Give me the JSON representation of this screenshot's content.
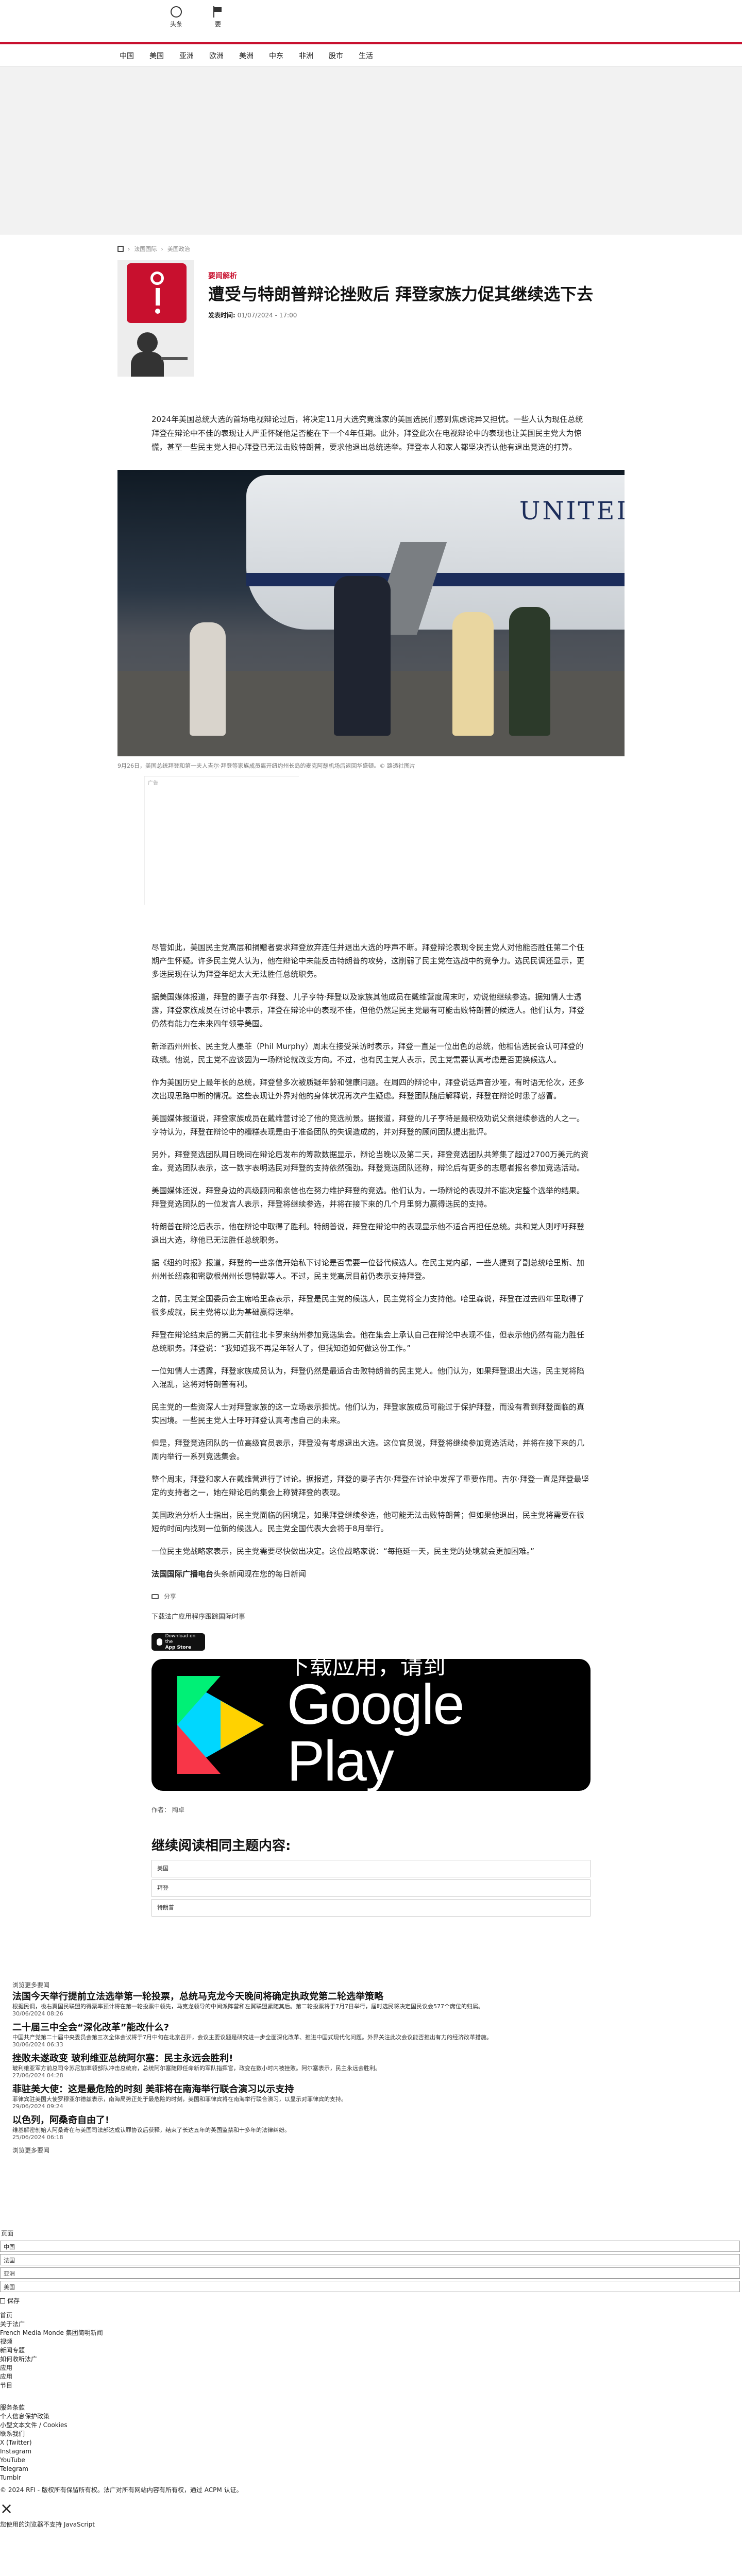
{
  "header": {
    "icons": [
      {
        "name": "home-icon",
        "label": "头条"
      },
      {
        "name": "flag-icon",
        "label": "要"
      }
    ],
    "nav": [
      "中国",
      "美国",
      "亚洲",
      "欧洲",
      "美洲",
      "中东",
      "非洲",
      "股市",
      "生活"
    ]
  },
  "breadcrumb": [
    "法国国际",
    "美国政治"
  ],
  "article": {
    "tag": "要闻解析",
    "title": "遭受与特朗普辩论挫败后 拜登家族力促其继续选下去",
    "date_label": "发表时间:",
    "date": "01/07/2024 - 17:00",
    "lead": "2024年美国总统大选的首场电视辩论过后，将决定11月大选究竟谁家的美国选民们感到焦虑诧异又担忧。一些人认为现任总统拜登在辩论中不佳的表现让人严重怀疑他是否能在下一个4年任期。此外，拜登此次在电视辩论中的表现也让美国民主党大为惊慌，甚至一些民主党人担心拜登已无法击败特朗普，要求他退出总统选举。拜登本人和家人都坚决否认他有退出竞选的打算。",
    "photo_caption": "9月26日，美国总统拜登和第一夫人吉尔·拜登等家族成员离开纽约州长岛的麦克阿瑟机场后返回华盛顿。© 路透社图片",
    "ad_label": "广告",
    "paragraphs": [
      "尽管如此，美国民主党高层和捐赠者要求拜登放弃连任并退出大选的呼声不断。拜登辩论表现令民主党人对他能否胜任第二个任期产生怀疑。许多民主党人认为，他在辩论中未能反击特朗普的攻势，这削弱了民主党在选战中的竞争力。选民民调还显示，更多选民现在认为拜登年纪太大无法胜任总统职务。",
      "据美国媒体报道，拜登的妻子吉尔·拜登、儿子亨特·拜登以及家族其他成员在戴维营度周末时，劝说他继续参选。据知情人士透露，拜登家族成员在讨论中表示，拜登在辩论中的表现不佳，但他仍然是民主党最有可能击败特朗普的候选人。他们认为，拜登仍然有能力在未来四年领导美国。",
      "新泽西州州长、民主党人墨菲（Phil Murphy）周末在接受采访时表示，拜登一直是一位出色的总统，他相信选民会认可拜登的政绩。他说，民主党不应该因为一场辩论就改变方向。不过，也有民主党人表示，民主党需要认真考虑是否更换候选人。",
      "作为美国历史上最年长的总统，拜登曾多次被质疑年龄和健康问题。在周四的辩论中，拜登说话声音沙哑，有时语无伦次，还多次出现思路中断的情况。这些表现让外界对他的身体状况再次产生疑虑。拜登团队随后解释说，拜登在辩论时患了感冒。",
      "美国媒体报道说，拜登家族成员在戴维营讨论了他的竞选前景。据报道，拜登的儿子亨特是最积极劝说父亲继续参选的人之一。亨特认为，拜登在辩论中的糟糕表现是由于准备团队的失误造成的，并对拜登的顾问团队提出批评。",
      "另外，拜登竞选团队周日晚间在辩论后发布的筹款数据显示，辩论当晚以及第二天，拜登竞选团队共筹集了超过2700万美元的资金。竞选团队表示，这一数字表明选民对拜登的支持依然强劲。拜登竞选团队还称，辩论后有更多的志愿者报名参加竞选活动。",
      "美国媒体还说，拜登身边的高级顾问和亲信也在努力维护拜登的竞选。他们认为，一场辩论的表现并不能决定整个选举的结果。拜登竞选团队的一位发言人表示，拜登将继续参选，并将在接下来的几个月里努力赢得选民的支持。",
      "特朗普在辩论后表示，他在辩论中取得了胜利。特朗普说，拜登在辩论中的表现显示他不适合再担任总统。共和党人则呼吁拜登退出大选，称他已无法胜任总统职务。",
      "据《纽约时报》报道，拜登的一些亲信开始私下讨论是否需要一位替代候选人。在民主党内部，一些人提到了副总统哈里斯、加州州长纽森和密歇根州州长惠特默等人。不过，民主党高层目前仍表示支持拜登。",
      "之前，民主党全国委员会主席哈里森表示，拜登是民主党的候选人，民主党将全力支持他。哈里森说，拜登在过去四年里取得了很多成就，民主党将以此为基础赢得选举。",
      "拜登在辩论结束后的第二天前往北卡罗来纳州参加竞选集会。他在集会上承认自己在辩论中表现不佳，但表示他仍然有能力胜任总统职务。拜登说：“我知道我不再是年轻人了，但我知道如何做这份工作。”",
      "一位知情人士透露，拜登家族成员认为，拜登仍然是最适合击败特朗普的民主党人。他们认为，如果拜登退出大选，民主党将陷入混乱，这将对特朗普有利。",
      "民主党的一些资深人士对拜登家族的这一立场表示担忧。他们认为，拜登家族成员可能过于保护拜登，而没有看到拜登面临的真实困境。一些民主党人士呼吁拜登认真考虑自己的未来。",
      "但是，拜登竞选团队的一位高级官员表示，拜登没有考虑退出大选。这位官员说，拜登将继续参加竞选活动，并将在接下来的几周内举行一系列竞选集会。",
      "整个周末，拜登和家人在戴维营进行了讨论。据报道，拜登的妻子吉尔·拜登在讨论中发挥了重要作用。吉尔·拜登一直是拜登最坚定的支持者之一，她在辩论后的集会上称赞拜登的表现。",
      "美国政治分析人士指出，民主党面临的困境是，如果拜登继续参选，他可能无法击败特朗普；但如果他退出，民主党将需要在很短的时间内找到一位新的候选人。民主党全国代表大会将于8月举行。",
      "一位民主党战略家表示，民主党需要尽快做出决定。这位战略家说：“每拖延一天，民主党的处境就会更加困难。”"
    ],
    "source_label": "法国国际广播电台",
    "source_text": "头条新闻现在您的每日新闻",
    "share_label": "分享",
    "download_line": "下载法广应用程序跟踪国际时事",
    "appstore_small": "Download on the",
    "appstore_big": "App Store",
    "gp_small": "下载应用，请到",
    "gp_big": "Google Play",
    "author_label": "作者：",
    "author": "陶卓",
    "related_title": "继续阅读相同主题内容:",
    "related": [
      "美国",
      "拜登",
      "特朗普"
    ]
  },
  "lower": {
    "more_label": "浏览更多要闻",
    "items": [
      {
        "title": "法国今天举行提前立法选举第一轮投票，总统马克龙今天晚间将确定执政党第二轮选举策略",
        "desc": "根据民调，极右翼国民联盟的得票率预计将在第一轮投票中领先，马克龙领导的中间派阵营和左翼联盟紧随其后。第二轮投票将于7月7日举行，届时选民将决定国民议会577个席位的归属。",
        "date": "30/06/2024 08:26"
      },
      {
        "title": "二十届三中全会“深化改革”能改什么?",
        "desc": "中国共产党第二十届中央委员会第三次全体会议将于7月中旬在北京召开，会议主要议题是研究进一步全面深化改革、推进中国式现代化问题。外界关注此次会议能否推出有力的经济改革措施。",
        "date": "30/06/2024 06:33"
      },
      {
        "title": "挫败未遂政变 玻利维亚总统阿尔塞：民主永远会胜利!",
        "desc": "玻利维亚军方前总司令苏尼加率领部队冲击总统府，总统阿尔塞随即任命新的军队指挥官，政变在数小时内被挫败。阿尔塞表示，民主永远会胜利。",
        "date": "27/06/2024 04:28"
      },
      {
        "title": "菲驻美大使：这是最危险的时刻 美菲将在南海举行联合演习以示支持",
        "desc": "菲律宾驻美国大使罗穆亚尔德兹表示，南海局势正处于最危险的时刻，美国和菲律宾将在南海举行联合演习，以显示对菲律宾的支持。",
        "date": "29/06/2024 09:24"
      },
      {
        "title": "以色列，阿桑奇自由了!",
        "desc": "维基解密创始人阿桑奇在与美国司法部达成认罪协议后获释，结束了长达五年的英国监禁和十多年的法律纠纷。",
        "date": "25/06/2024 06:18"
      }
    ],
    "footer_more": "浏览更多要闻"
  },
  "misc": {
    "label": "页面",
    "selects": [
      "中国",
      "法国",
      "亚洲",
      "美国"
    ],
    "checkbox_label": "保存",
    "list1": [
      "首页",
      "关于法广",
      "French Media Monde 集团简明新闻",
      "视频",
      "新闻专题",
      "如何收听法广",
      "应用",
      "应用",
      "节目"
    ],
    "list2": [
      "服务条款",
      "个人信息保护政策",
      "小型文本文件 / Cookies",
      "联系我们",
      "X (Twitter)",
      "Instagram",
      "YouTube",
      "Telegram",
      "Tumblr"
    ],
    "copyright": "© 2024 RFI - 版权所有保留所有权。法广对所有网站内容有所有权，通过 ACPM 认证。",
    "close_hint": "×",
    "status": "您使用的浏览器不支持 JavaScript"
  }
}
